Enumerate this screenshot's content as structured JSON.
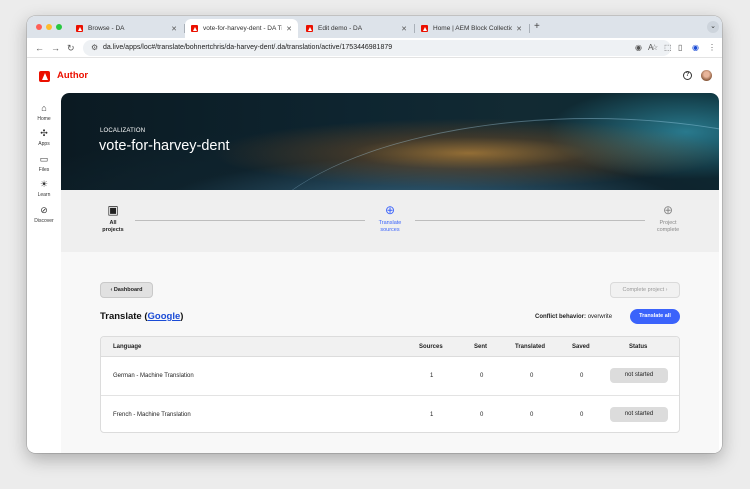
{
  "browser": {
    "tabs": [
      {
        "label": "Browse - DA",
        "active": false
      },
      {
        "label": "vote-for-harvey-dent - DA Tr",
        "active": true
      },
      {
        "label": "Edit demo - DA",
        "active": false
      },
      {
        "label": "Home | AEM Block Collection",
        "active": false
      }
    ],
    "new_tab_label": "+",
    "tab_menu_label": "⌄",
    "url": "da.live/apps/loc#/translate/bohnertchris/da-harvey-dent/.da/translation/active/1753446981879"
  },
  "app": {
    "brand": "Author",
    "help_icon_label": "?"
  },
  "sidebar": {
    "items": [
      {
        "label": "Home",
        "icon": "home-icon"
      },
      {
        "label": "Apps",
        "icon": "apps-icon"
      },
      {
        "label": "Files",
        "icon": "folder-icon"
      },
      {
        "label": "Learn",
        "icon": "lightbulb-icon"
      },
      {
        "label": "Discover",
        "icon": "compass-icon"
      }
    ]
  },
  "hero": {
    "overline": "LOCALIZATION",
    "title": "vote-for-harvey-dent"
  },
  "stepper": {
    "steps": [
      {
        "line1": "All",
        "line2": "projects",
        "state": "done",
        "icon": "archive-icon"
      },
      {
        "line1": "Translate",
        "line2": "sources",
        "state": "active",
        "icon": "globe-icon"
      },
      {
        "line1": "Project",
        "line2": "complete",
        "state": "pending",
        "icon": "globe-icon"
      }
    ]
  },
  "actions": {
    "dashboard_label": "Dashboard",
    "complete_label": "Complete project",
    "translate_all_label": "Translate all"
  },
  "translate": {
    "heading_prefix": "Translate (",
    "service": "Google",
    "heading_suffix": ")",
    "conflict_label": "Conflict behavior:",
    "conflict_value": "overwrite"
  },
  "table": {
    "headers": [
      "Language",
      "Sources",
      "Sent",
      "Translated",
      "Saved",
      "Status"
    ],
    "rows": [
      {
        "language": "German - Machine Translation",
        "sources": "1",
        "sent": "0",
        "translated": "0",
        "saved": "0",
        "status": "not started"
      },
      {
        "language": "French - Machine Translation",
        "sources": "1",
        "sent": "0",
        "translated": "0",
        "saved": "0",
        "status": "not started"
      }
    ]
  },
  "colors": {
    "brand_red": "#eb1000",
    "accent_blue": "#3b63fb",
    "link_blue": "#1a4bd6"
  }
}
